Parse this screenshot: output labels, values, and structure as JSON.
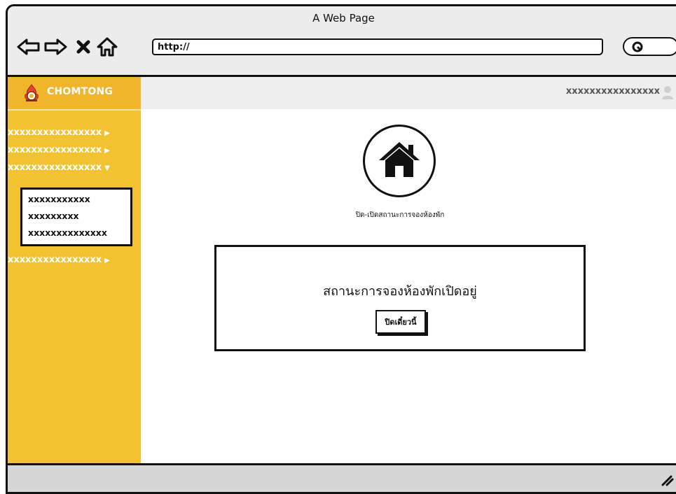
{
  "window": {
    "title": "A Web Page"
  },
  "toolbar": {
    "back_icon": "back-arrow-icon",
    "forward_icon": "forward-arrow-icon",
    "stop_icon": "close-x-icon",
    "home_icon": "home-outline-icon",
    "url_value": "http://",
    "search_icon": "search-icon"
  },
  "sidebar": {
    "brand_name": "CHOMTONG",
    "brand_logo": "flame-logo-icon",
    "items": [
      {
        "label": "xxxxxxxxxxxxxxxx",
        "arrow": "▶"
      },
      {
        "label": "xxxxxxxxxxxxxxxx",
        "arrow": "▶"
      },
      {
        "label": "xxxxxxxxxxxxxxxx",
        "arrow": "▼"
      },
      {
        "label": "xxxxxxxxxxxxxxxx",
        "arrow": "▶"
      }
    ],
    "submenu": [
      "xxxxxxxxxxx",
      "xxxxxxxxx",
      "xxxxxxxxxxxxxx"
    ]
  },
  "header": {
    "user_name": "xxxxxxxxxxxxxxxx",
    "user_icon": "user-icon"
  },
  "main": {
    "home_icon": "home-icon",
    "caption": "ปิด-เปิดสถานะการจองห้องพัก",
    "status_text": "สถานะการจองห้องพักเปิดอยู่",
    "close_button_label": "ปิดเดี๋ยวนี้"
  },
  "colors": {
    "sidebar": "#f2c230",
    "brand_bar": "#f0b52a",
    "topbar": "#eeeeee",
    "chrome": "#ececec",
    "statusbar": "#d6d6d6"
  }
}
